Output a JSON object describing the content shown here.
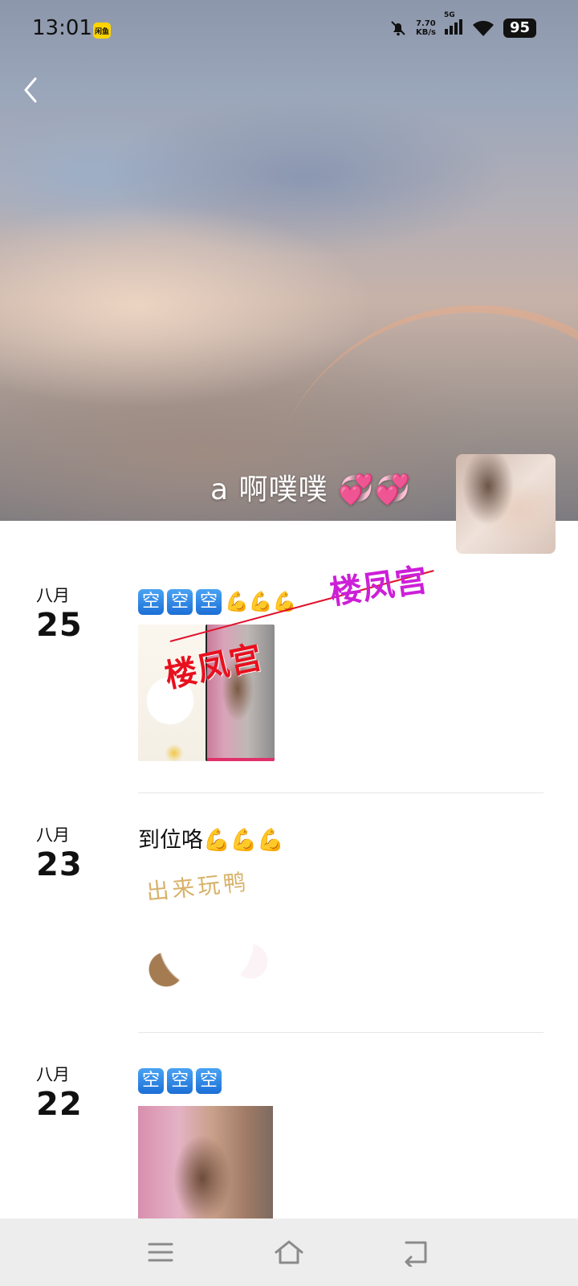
{
  "status_bar": {
    "time": "13:01",
    "app_badge": "闲鱼",
    "net_speed_value": "7.70",
    "net_speed_unit": "KB/s",
    "network": "5G",
    "battery": "95",
    "icons": [
      "mute-bell-icon",
      "signal-icon",
      "wifi-icon",
      "battery-icon"
    ]
  },
  "header": {
    "back_icon": "chevron-left-icon",
    "profile_name": "a  啊噗噗",
    "profile_hearts": "💞💞"
  },
  "posts": [
    {
      "month": "八月",
      "day": "25",
      "text_kong": [
        "空",
        "空",
        "空"
      ],
      "text_suffix": "💪💪💪",
      "images": [
        "sticker-image",
        "photo-image"
      ],
      "overlay_stamps": [
        "楼凤宫",
        "楼凤宫"
      ]
    },
    {
      "month": "八月",
      "day": "23",
      "text": "到位咯💪💪💪",
      "sticker_caption": "出来玩鸭",
      "images": [
        "sticker-image"
      ]
    },
    {
      "month": "八月",
      "day": "22",
      "text_kong": [
        "空",
        "空",
        "空"
      ],
      "images": [
        "photo-image"
      ]
    }
  ],
  "nav_bar": {
    "icons": [
      "menu-icon",
      "home-icon",
      "back-icon"
    ]
  }
}
